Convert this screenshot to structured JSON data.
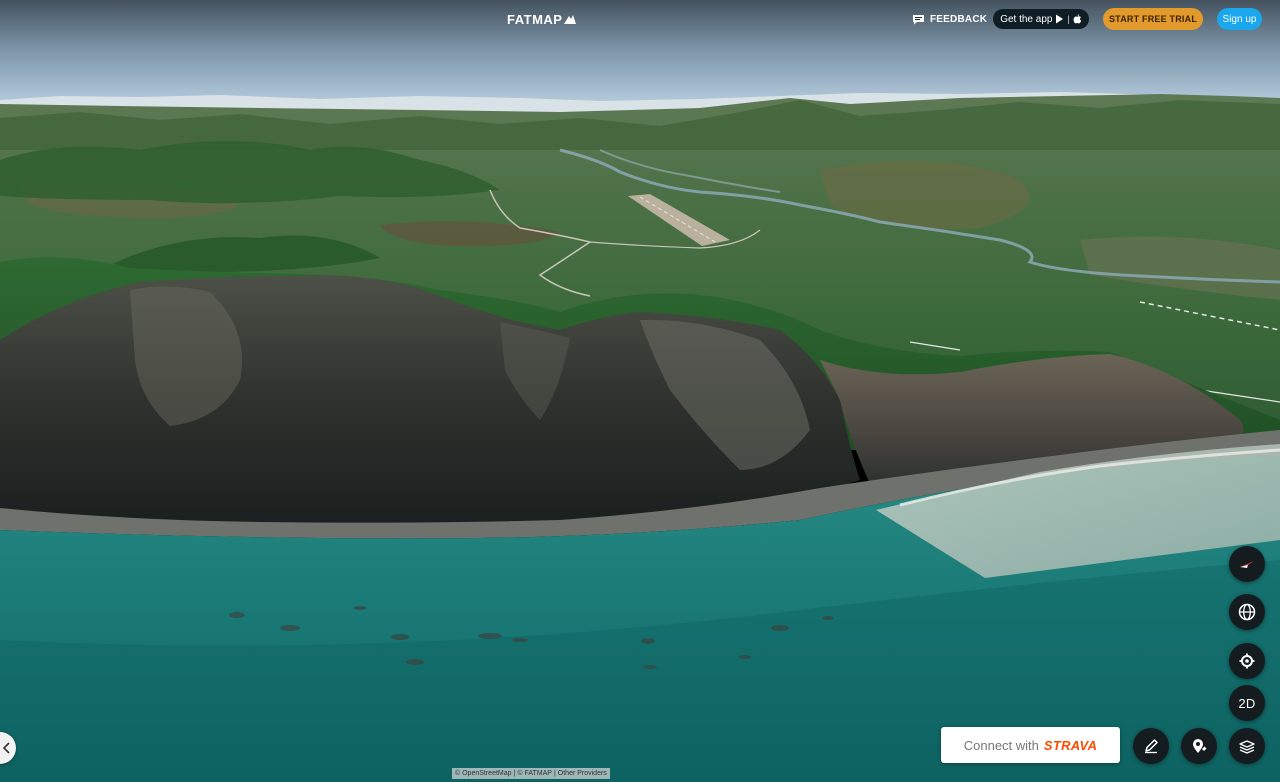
{
  "app": {
    "logo_text": "FATMAP"
  },
  "header": {
    "feedback_label": "FEEDBACK",
    "get_app_label": "Get the app",
    "get_app_separator": "|",
    "trial_label": "START FREE TRIAL",
    "signup_label": "Sign up"
  },
  "map_controls": {
    "compass": {
      "icon": "compass-icon"
    },
    "globe": {
      "icon": "globe-icon"
    },
    "locate": {
      "icon": "locate-icon"
    },
    "view_mode_label": "2D",
    "draw": {
      "icon": "pencil-icon"
    },
    "places": {
      "icon": "map-pin-icon"
    },
    "layers": {
      "icon": "layers-icon"
    }
  },
  "strava": {
    "connect_label": "Connect with",
    "brand_label": "STRAVA"
  },
  "sidebar_toggle": {
    "icon": "chevron-left-icon"
  },
  "attribution": {
    "osm": "© OpenStreetMap",
    "sep1": "|",
    "fatmap": "© FATMAP",
    "sep2": "|",
    "providers": "Other Providers"
  },
  "colors": {
    "trial": "#e39a2c",
    "signup": "#1aa7ee",
    "strava": "#fc4c02",
    "control_bg": "#141c20",
    "get_app_bg": "#0f1d24"
  }
}
